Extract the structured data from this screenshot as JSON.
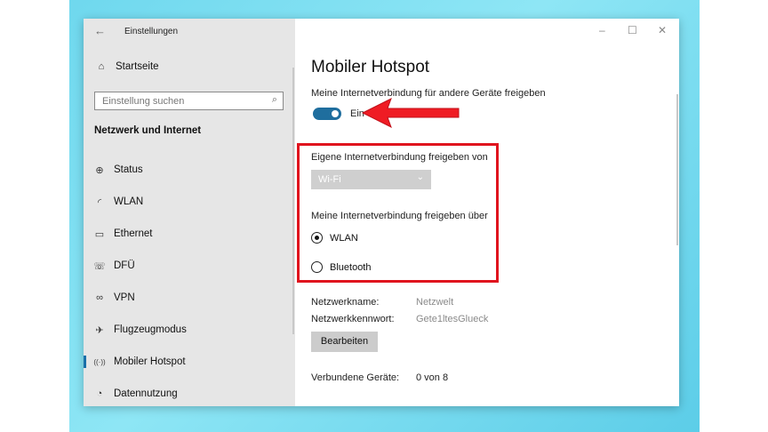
{
  "window": {
    "title": "Einstellungen",
    "back_icon": "arrow-left-icon",
    "minimize": "–",
    "maximize": "☐",
    "close": "✕"
  },
  "sidebar": {
    "home_label": "Startseite",
    "search_placeholder": "Einstellung suchen",
    "section_title": "Netzwerk und Internet",
    "items": [
      {
        "label": "Status",
        "icon": "globe-status-icon",
        "glyph": "⊕"
      },
      {
        "label": "WLAN",
        "icon": "wifi-icon",
        "glyph": "◜"
      },
      {
        "label": "Ethernet",
        "icon": "ethernet-icon",
        "glyph": "▭"
      },
      {
        "label": "DFÜ",
        "icon": "dialup-icon",
        "glyph": "☏"
      },
      {
        "label": "VPN",
        "icon": "vpn-icon",
        "glyph": "∞"
      },
      {
        "label": "Flugzeugmodus",
        "icon": "airplane-icon",
        "glyph": "✈"
      },
      {
        "label": "Mobiler Hotspot",
        "icon": "hotspot-icon",
        "glyph": "((·))"
      },
      {
        "label": "Datennutzung",
        "icon": "data-usage-icon",
        "glyph": "◔"
      }
    ],
    "active_index": 6
  },
  "main": {
    "title": "Mobiler Hotspot",
    "share_label": "Meine Internetverbindung für andere Geräte freigeben",
    "toggle_on": true,
    "toggle_state_label": "Ein",
    "share_from_label": "Eigene Internetverbindung freigeben von",
    "share_from_value": "Wi-Fi",
    "share_over_label": "Meine Internetverbindung freigeben über",
    "radio_options": [
      {
        "label": "WLAN",
        "selected": true
      },
      {
        "label": "Bluetooth",
        "selected": false
      }
    ],
    "network_name_label": "Netzwerkname:",
    "network_name_value": "Netzwelt",
    "network_password_label": "Netzwerkkennwort:",
    "network_password_value": "Gete1ltesGlueck",
    "edit_button": "Bearbeiten",
    "connected_devices_label": "Verbundene Geräte:",
    "connected_devices_value": "0 von 8"
  },
  "colors": {
    "accent": "#1f6e9e",
    "highlight_red": "#e0141e",
    "sidebar_bg": "#e6e6e6",
    "desktop_bg": "#7fdff2"
  }
}
